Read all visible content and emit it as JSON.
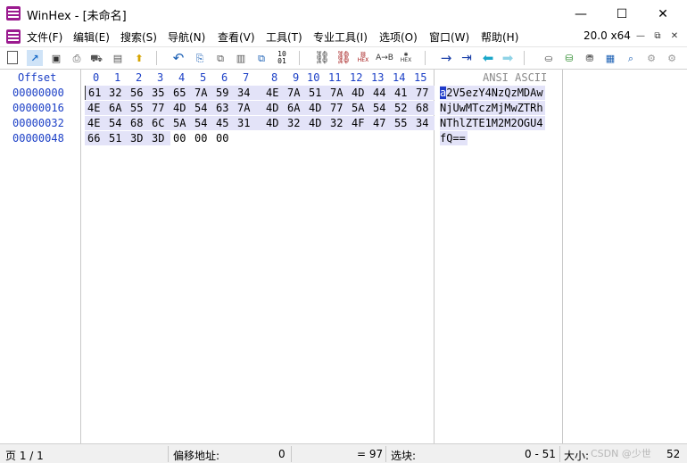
{
  "window": {
    "title": "WinHex - [未命名]",
    "minimize_icon": "—",
    "maximize_icon": "☐",
    "close_icon": "✕"
  },
  "menu": {
    "items": [
      "文件(F)",
      "编辑(E)",
      "搜索(S)",
      "导航(N)",
      "查看(V)",
      "工具(T)",
      "专业工具(I)",
      "选项(O)",
      "窗口(W)",
      "帮助(H)"
    ],
    "version": "20.0 x64",
    "doc_minimize": "—",
    "doc_restore": "⧉",
    "doc_close": "✕"
  },
  "toolbar": {
    "icons": [
      {
        "name": "new-file-icon",
        "glyph": "🗋"
      },
      {
        "name": "open-icon",
        "glyph": "↗"
      },
      {
        "name": "save-icon",
        "glyph": "💾"
      },
      {
        "name": "print-icon",
        "glyph": "⎙"
      },
      {
        "name": "properties-icon",
        "glyph": "⛟"
      },
      {
        "name": "export-icon",
        "glyph": "⬆"
      },
      {
        "name": "undo-icon",
        "glyph": "↶"
      },
      {
        "name": "copy-icon",
        "glyph": "⎘"
      },
      {
        "name": "copy-block-icon",
        "glyph": "⧉"
      },
      {
        "name": "paste-icon",
        "glyph": "📋"
      },
      {
        "name": "paste-block-icon",
        "glyph": "⧉"
      },
      {
        "name": "binary-icon",
        "glyph": "01"
      },
      {
        "name": "find-text-icon",
        "glyph": "🔭"
      },
      {
        "name": "find-hex-icon",
        "glyph": "🔭"
      },
      {
        "name": "replace-text-icon",
        "glyph": "HEX"
      },
      {
        "name": "replace-hex-icon",
        "glyph": "AB"
      },
      {
        "name": "find-hex-values-icon",
        "glyph": "HEX"
      },
      {
        "name": "goto-offset-icon",
        "glyph": "→"
      },
      {
        "name": "goto-sector-icon",
        "glyph": "⇥"
      },
      {
        "name": "back-icon",
        "glyph": "⬅"
      },
      {
        "name": "forward-icon",
        "glyph": "➡"
      },
      {
        "name": "open-disk-icon",
        "glyph": "⛀"
      },
      {
        "name": "save-disk-icon",
        "glyph": "⛁"
      },
      {
        "name": "disk-tools-icon",
        "glyph": "⛃"
      },
      {
        "name": "calculator-icon",
        "glyph": "▦"
      },
      {
        "name": "zoom-icon",
        "glyph": "🔍"
      },
      {
        "name": "hash-icon",
        "glyph": "⚙"
      },
      {
        "name": "settings-icon",
        "glyph": "⚙"
      }
    ]
  },
  "editor": {
    "offset_header": "Offset",
    "ascii_header": "ANSI ASCII",
    "columns": [
      "0",
      "1",
      "2",
      "3",
      "4",
      "5",
      "6",
      "7",
      "8",
      "9",
      "10",
      "11",
      "12",
      "13",
      "14",
      "15"
    ],
    "rows": [
      {
        "offset": "00000000",
        "hex": [
          "61",
          "32",
          "56",
          "35",
          "65",
          "7A",
          "59",
          "34",
          "4E",
          "7A",
          "51",
          "7A",
          "4D",
          "44",
          "41",
          "77"
        ],
        "ascii_first": "a",
        "ascii_rest": "2V5ezY4NzQzMDAw"
      },
      {
        "offset": "00000016",
        "hex": [
          "4E",
          "6A",
          "55",
          "77",
          "4D",
          "54",
          "63",
          "7A",
          "4D",
          "6A",
          "4D",
          "77",
          "5A",
          "54",
          "52",
          "68"
        ],
        "ascii_first": "",
        "ascii_rest": "NjUwMTczMjMwZTRh"
      },
      {
        "offset": "00000032",
        "hex": [
          "4E",
          "54",
          "68",
          "6C",
          "5A",
          "54",
          "45",
          "31",
          "4D",
          "32",
          "4D",
          "32",
          "4F",
          "47",
          "55",
          "34"
        ],
        "ascii_first": "",
        "ascii_rest": "NThlZTE1M2M2OGU4"
      },
      {
        "offset": "00000048",
        "hex": [
          "66",
          "51",
          "3D",
          "3D",
          "00",
          "00",
          "00"
        ],
        "ascii_first": "",
        "ascii_rest": "fQ=="
      }
    ]
  },
  "status": {
    "page": "页 1 / 1",
    "offset_label": "偏移地址:",
    "offset_value": "0",
    "value": "= 97",
    "block_label": "选块:",
    "block_value": "0 - 51",
    "size_label": "大小:",
    "size_value": "52",
    "watermark": "CSDN @少世"
  }
}
